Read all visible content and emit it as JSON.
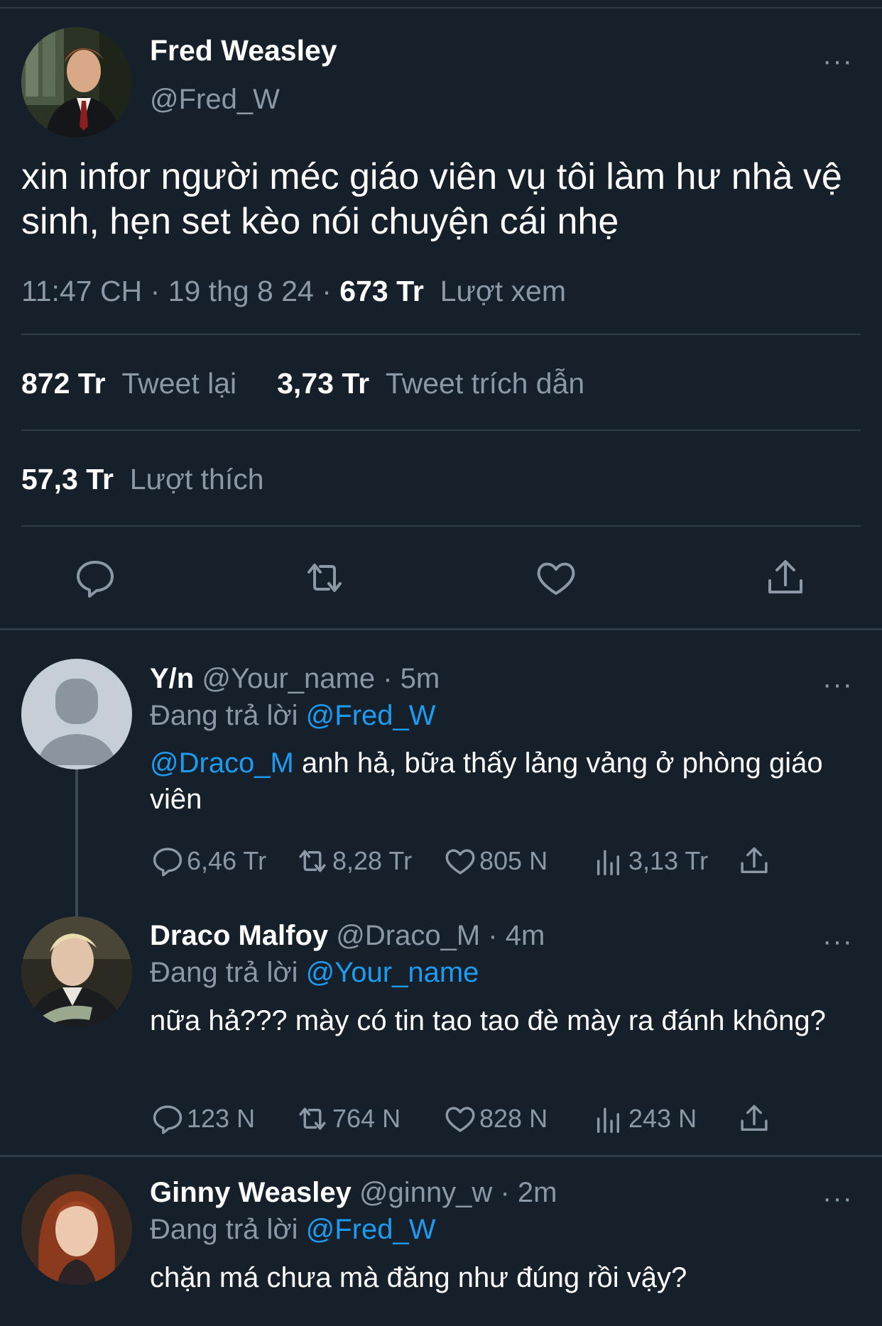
{
  "main": {
    "name": "Fred Weasley",
    "handle": "@Fred_W",
    "text": "xin infor người méc giáo viên vụ tôi làm hư nhà vệ sinh, hẹn set kèo nói chuyện cái nhẹ",
    "time": "11:47 CH",
    "sep": "·",
    "date": "19 thg 8 24",
    "views_count": "673 Tr",
    "views_label": "Lượt xem",
    "retweets_count": "872 Tr",
    "retweets_label": "Tweet lại",
    "quotes_count": "3,73 Tr",
    "quotes_label": "Tweet trích dẫn",
    "likes_count": "57,3 Tr",
    "likes_label": "Lượt thích",
    "more": "···"
  },
  "replies": [
    {
      "name": "Y/n",
      "handle": "@Your_name",
      "time": "· 5m",
      "replying_label": "Đang trả lời",
      "replying_to": "@Fred_W",
      "mention": "@Draco_M",
      "text": " anh hả, bữa thấy lảng vảng ở phòng giáo viên",
      "replies": "6,46 Tr",
      "retweets": "8,28 Tr",
      "likes": "805 N",
      "views": "3,13 Tr",
      "more": "···"
    },
    {
      "name": "Draco Malfoy",
      "handle": "@Draco_M",
      "time": "· 4m",
      "replying_label": "Đang trả lời",
      "replying_to": "@Your_name",
      "text": "nữa hả??? mày có tin tao tao đè mày ra đánh không?",
      "replies": "123 N",
      "retweets": "764 N",
      "likes": "828 N",
      "views": "243 N",
      "more": "···"
    },
    {
      "name": "Ginny Weasley",
      "handle": "@ginny_w",
      "time": "· 2m",
      "replying_label": "Đang trả lời",
      "replying_to": "@Fred_W",
      "text": "chặn má chưa mà đăng như đúng rồi vậy?",
      "more": "···"
    }
  ],
  "colors": {
    "background": "#15202b",
    "text": "#ffffff",
    "secondary": "#8b98a5",
    "link": "#1d9bf0",
    "divider": "#2f3b47"
  },
  "icons": [
    "reply-icon",
    "retweet-icon",
    "like-icon",
    "share-icon",
    "views-icon",
    "more-icon"
  ]
}
